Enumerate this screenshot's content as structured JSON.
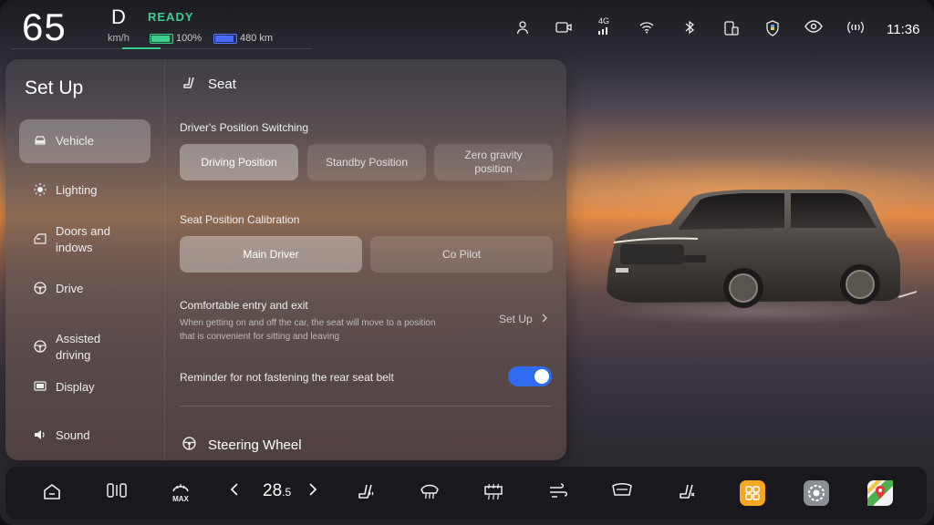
{
  "status_bar": {
    "speed": "65",
    "gear": "D",
    "ready": "READY",
    "speed_unit": "km/h",
    "battery_percent": "100%",
    "range": "480 km",
    "time": "11:36",
    "signal_label": "4G",
    "icons": [
      "person-icon",
      "camera-icon",
      "signal-4g-icon",
      "wifi-icon",
      "bluetooth-icon",
      "phone-link-icon",
      "shield-icon",
      "eye-icon",
      "radio-icon"
    ]
  },
  "sidebar": {
    "title": "Set Up",
    "items": [
      {
        "label": "Vehicle",
        "icon": "car-icon"
      },
      {
        "label": "Lighting",
        "icon": "light-icon"
      },
      {
        "label": "Doors and indows",
        "icon": "door-icon"
      },
      {
        "label": "Drive",
        "icon": "steering-icon"
      },
      {
        "label": "Assisted driving",
        "icon": "assist-icon"
      },
      {
        "label": "Display",
        "icon": "display-icon"
      },
      {
        "label": "Sound",
        "icon": "speaker-icon"
      }
    ]
  },
  "seat_section": {
    "title": "Seat",
    "position_switching": {
      "label": "Driver's Position Switching",
      "options": [
        "Driving Position",
        "Standby Position",
        "Zero gravity position"
      ],
      "selected": "Driving Position"
    },
    "calibration": {
      "label": "Seat Position Calibration",
      "options": [
        "Main Driver",
        "Co Pilot"
      ],
      "selected": "Main Driver"
    },
    "comfort_entry": {
      "label": "Comfortable entry and exit",
      "description": "When getting on and off the car, the seat will move to a position that is convenient for sitting and leaving",
      "action": "Set Up"
    },
    "seatbelt_reminder": {
      "label": "Reminder for not fastening the rear seat belt",
      "enabled": true
    }
  },
  "steering_section": {
    "title": "Steering Wheel"
  },
  "dock": {
    "temperature_main": "28",
    "temperature_decimal": ".5",
    "max_label": "MAX",
    "icons": [
      "home-icon",
      "split-view-icon",
      "max-defrost-icon",
      "temp-decrease-icon",
      "temp-increase-icon",
      "seat-heat-icon",
      "front-defrost-icon",
      "rear-defrost-icon",
      "airflow-icon",
      "windshield-icon",
      "seat-vent-icon",
      "apps-icon",
      "settings-icon",
      "maps-icon"
    ]
  },
  "colors": {
    "ready": "#3ccf8e",
    "toggle_on": "#2f6cf0",
    "apps_tile": "#f5a623"
  }
}
